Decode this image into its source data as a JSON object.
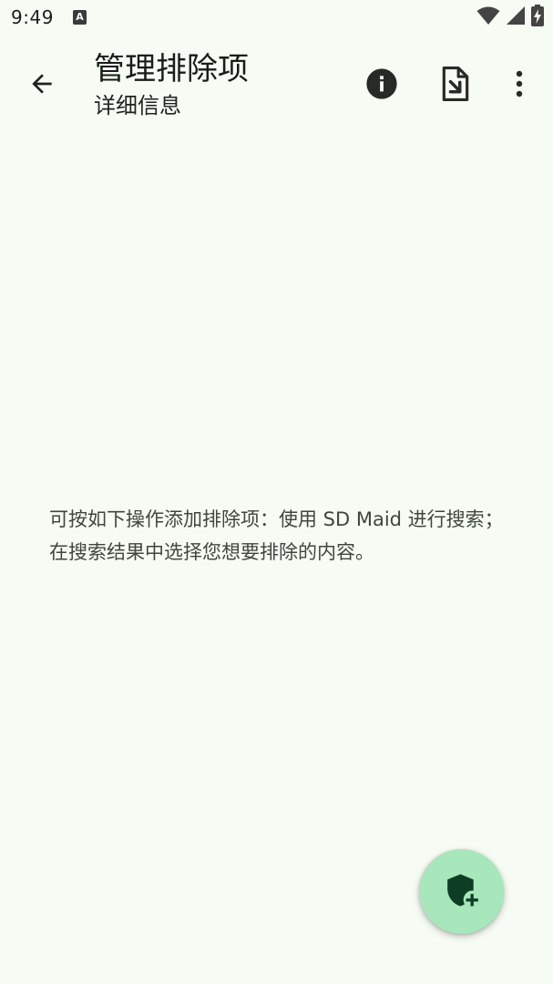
{
  "status_bar": {
    "time": "9:49",
    "notification_icon": "a-letter-icon",
    "notification_letter": "A",
    "icons": [
      "wifi-icon",
      "signal-icon",
      "battery-charging-icon"
    ]
  },
  "app_bar": {
    "title": "管理排除项",
    "subtitle": "详细信息",
    "back_icon": "arrow-back-icon",
    "actions": [
      "info-icon",
      "file-import-icon",
      "more-vert-icon"
    ]
  },
  "main": {
    "empty_message": "可按如下操作添加排除项：使用 SD Maid 进行搜索；在搜索结果中选择您想要排除的内容。"
  },
  "fab": {
    "icon": "shield-plus-icon"
  },
  "colors": {
    "background": "#f6fbf3",
    "fab_background": "#a8e6bb",
    "fab_icon": "#0d3d22",
    "text_primary": "#171d17",
    "text_secondary": "#3e473e"
  }
}
